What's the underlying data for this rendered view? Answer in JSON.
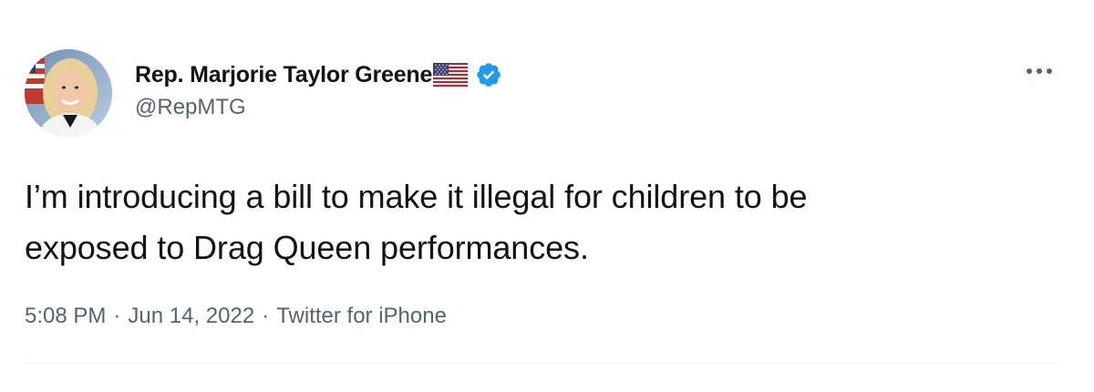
{
  "author": {
    "display_name": "Rep. Marjorie Taylor Greene",
    "handle": "@RepMTG",
    "avatar_icon": "profile-photo",
    "flag_icon": "us-flag-icon",
    "verified_icon": "verified-badge-icon"
  },
  "tweet": {
    "text": "I’m introducing a bill to make it illegal for children to be\nexposed to Drag Queen performances."
  },
  "meta": {
    "time": "5:08 PM",
    "separator": "·",
    "date": "Jun 14, 2022",
    "source": "Twitter for iPhone"
  },
  "colors": {
    "text_primary": "#0f1419",
    "text_secondary": "#536471",
    "verified_blue": "#1d9bf0",
    "divider": "#eff3f4"
  }
}
